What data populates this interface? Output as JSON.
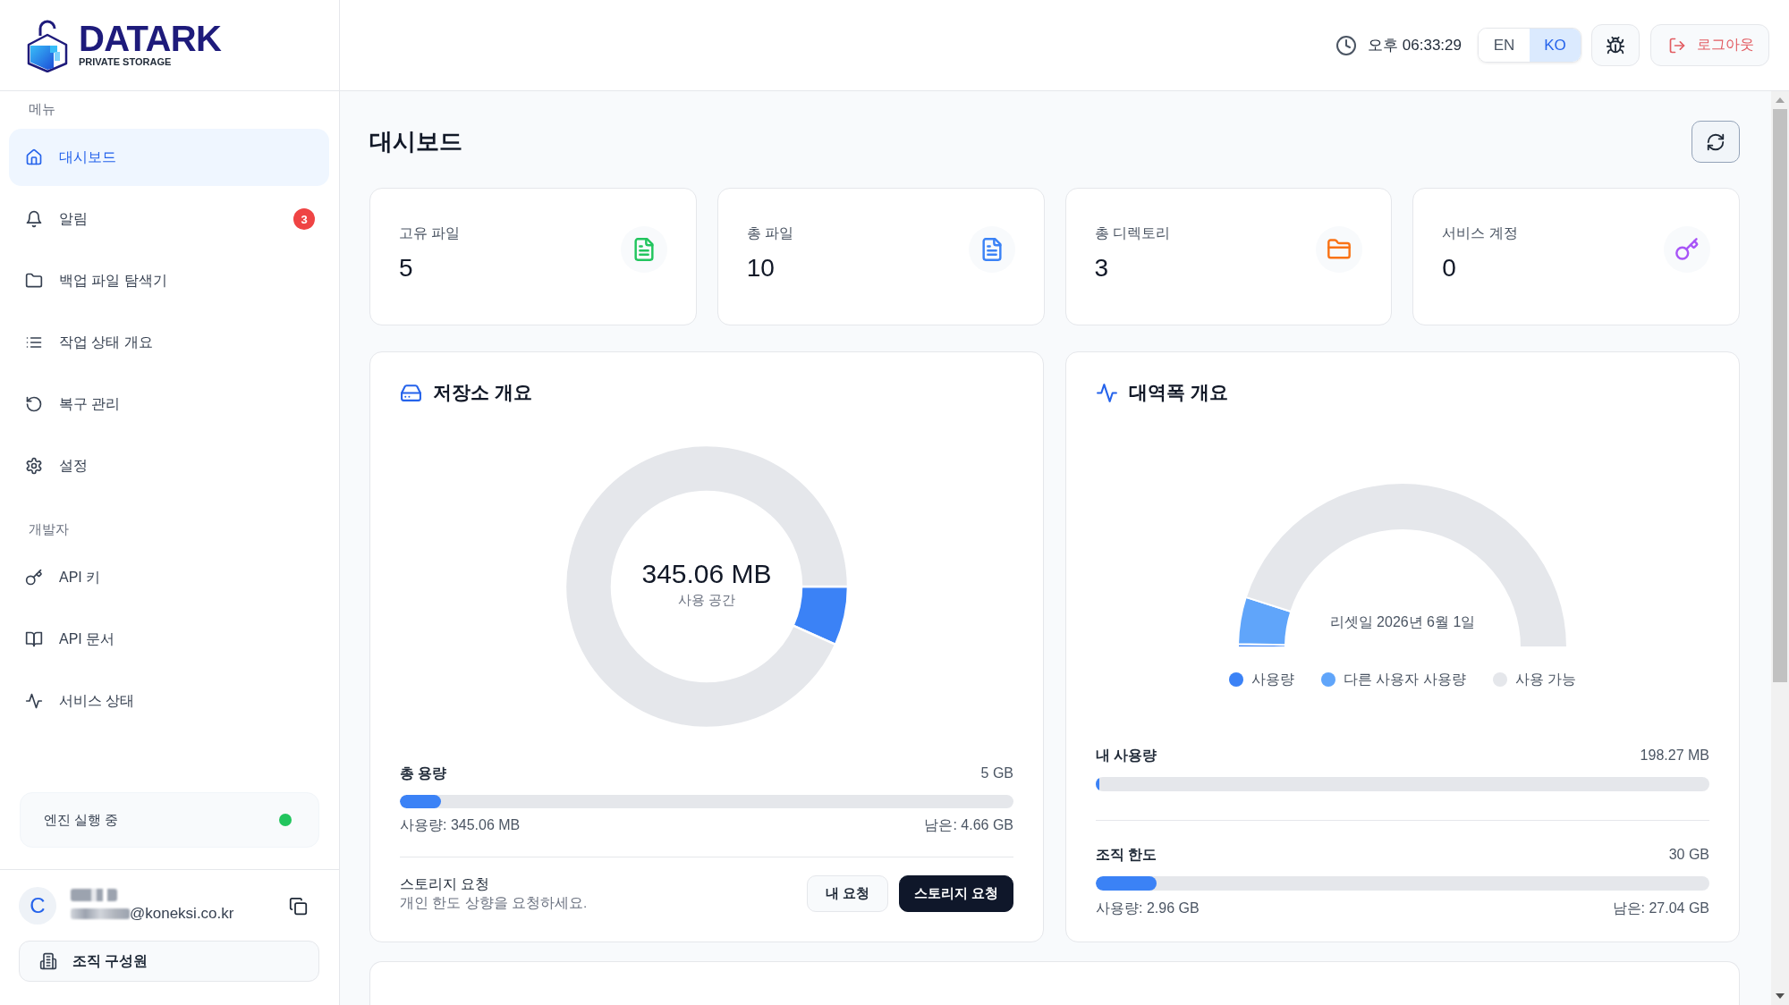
{
  "sidebar": {
    "logo": {
      "wordmark": "DATARK",
      "tagline": "PRIVATE STORAGE"
    },
    "sections": [
      {
        "label": "메뉴",
        "items": [
          {
            "label": "대시보드",
            "selected": true
          },
          {
            "label": "알림",
            "selected": false,
            "badge": "3"
          },
          {
            "label": "백업 파일 탐색기",
            "selected": false
          },
          {
            "label": "작업 상태 개요",
            "selected": false
          },
          {
            "label": "복구 관리",
            "selected": false
          },
          {
            "label": "설정",
            "selected": false
          }
        ]
      },
      {
        "label": "개발자",
        "items": [
          {
            "label": "API 키",
            "selected": false
          },
          {
            "label": "API 문서",
            "selected": false
          },
          {
            "label": "서비스 상태",
            "selected": false
          }
        ]
      }
    ],
    "engine_status": {
      "label": "엔진 실행 중",
      "running": true
    },
    "user": {
      "avatar": "C",
      "email_visible": "@koneksi.co.kr"
    },
    "org_button": "조직 구성원"
  },
  "header": {
    "time": "오후 06:33:29",
    "languages": [
      {
        "label": "EN",
        "selected": false
      },
      {
        "label": "KO",
        "selected": true
      }
    ],
    "logout": "로그아웃"
  },
  "page": {
    "title": "대시보드"
  },
  "stats": [
    {
      "label": "고유 파일",
      "value": "5",
      "color": "#22c55e"
    },
    {
      "label": "총 파일",
      "value": "10",
      "color": "#3b82f6"
    },
    {
      "label": "총 디렉토리",
      "value": "3",
      "color": "#f97316"
    },
    {
      "label": "서비스 계정",
      "value": "0",
      "color": "#a855f7"
    }
  ],
  "storage": {
    "title": "저장소 개요",
    "chart_data": {
      "type": "donut",
      "values": [
        6.74,
        93.26
      ]
    },
    "center_value": "345.06 MB",
    "center_label": "사용 공간",
    "total_label": "총 용량",
    "total_value": "5 GB",
    "level": 0.0674,
    "used": "사용량: 345.06 MB",
    "remaining": "남은: 4.66 GB",
    "request": {
      "title": "스토리지 요청",
      "description": "개인 한도 상향을 요청하세요."
    },
    "buttons": [
      {
        "label": "내 요청",
        "kind": "secondary"
      },
      {
        "label": "스토리지 요청",
        "kind": "primary"
      }
    ]
  },
  "bandwidth": {
    "title": "대역폭 개요",
    "chart_data": {
      "type": "donut",
      "values": [
        0.65,
        9.22,
        90.13
      ]
    },
    "center_label": "리셋일 2026년 6월 1일",
    "legend": [
      {
        "label": "사용량",
        "color": "#3b82f6"
      },
      {
        "label": "다른 사용자 사용량",
        "color": "#60a5fa"
      },
      {
        "label": "사용 가능",
        "color": "#e5e7eb"
      }
    ],
    "meters": [
      {
        "label": "내 사용량",
        "value": "198.27 MB",
        "level": 0.0065
      },
      {
        "label": "조직 한도",
        "value": "30 GB",
        "level": 0.0987,
        "used": "사용량: 2.96 GB",
        "remaining": "남은: 27.04 GB"
      }
    ]
  }
}
